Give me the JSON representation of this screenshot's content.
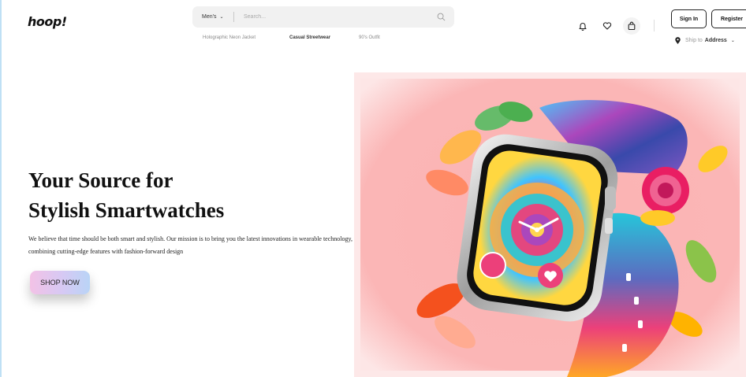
{
  "header": {
    "logo": "hoop!",
    "search": {
      "category": "Men's",
      "placeholder": "Search..."
    },
    "suggestions": [
      {
        "label": "Holographic Neon Jacket",
        "active": false
      },
      {
        "label": "Casual Streetwear",
        "active": true
      },
      {
        "label": "90's Outfit",
        "active": false
      }
    ],
    "icons": [
      "bell-icon",
      "heart-icon",
      "shopping-bag-icon"
    ],
    "sign_in": "Sign In",
    "register": "Register",
    "ship_to": {
      "label": "Ship to",
      "value": "Address"
    }
  },
  "hero": {
    "title_line1": "Your Source for",
    "title_line2": "Stylish Smartwatches",
    "description": "We believe that time should be both smart and stylish. Our mission is to bring you the latest innovations in wearable technology, combining cutting-edge features with fashion-forward design",
    "cta": "SHOP NOW",
    "image_bg": "#fbb6b6"
  }
}
